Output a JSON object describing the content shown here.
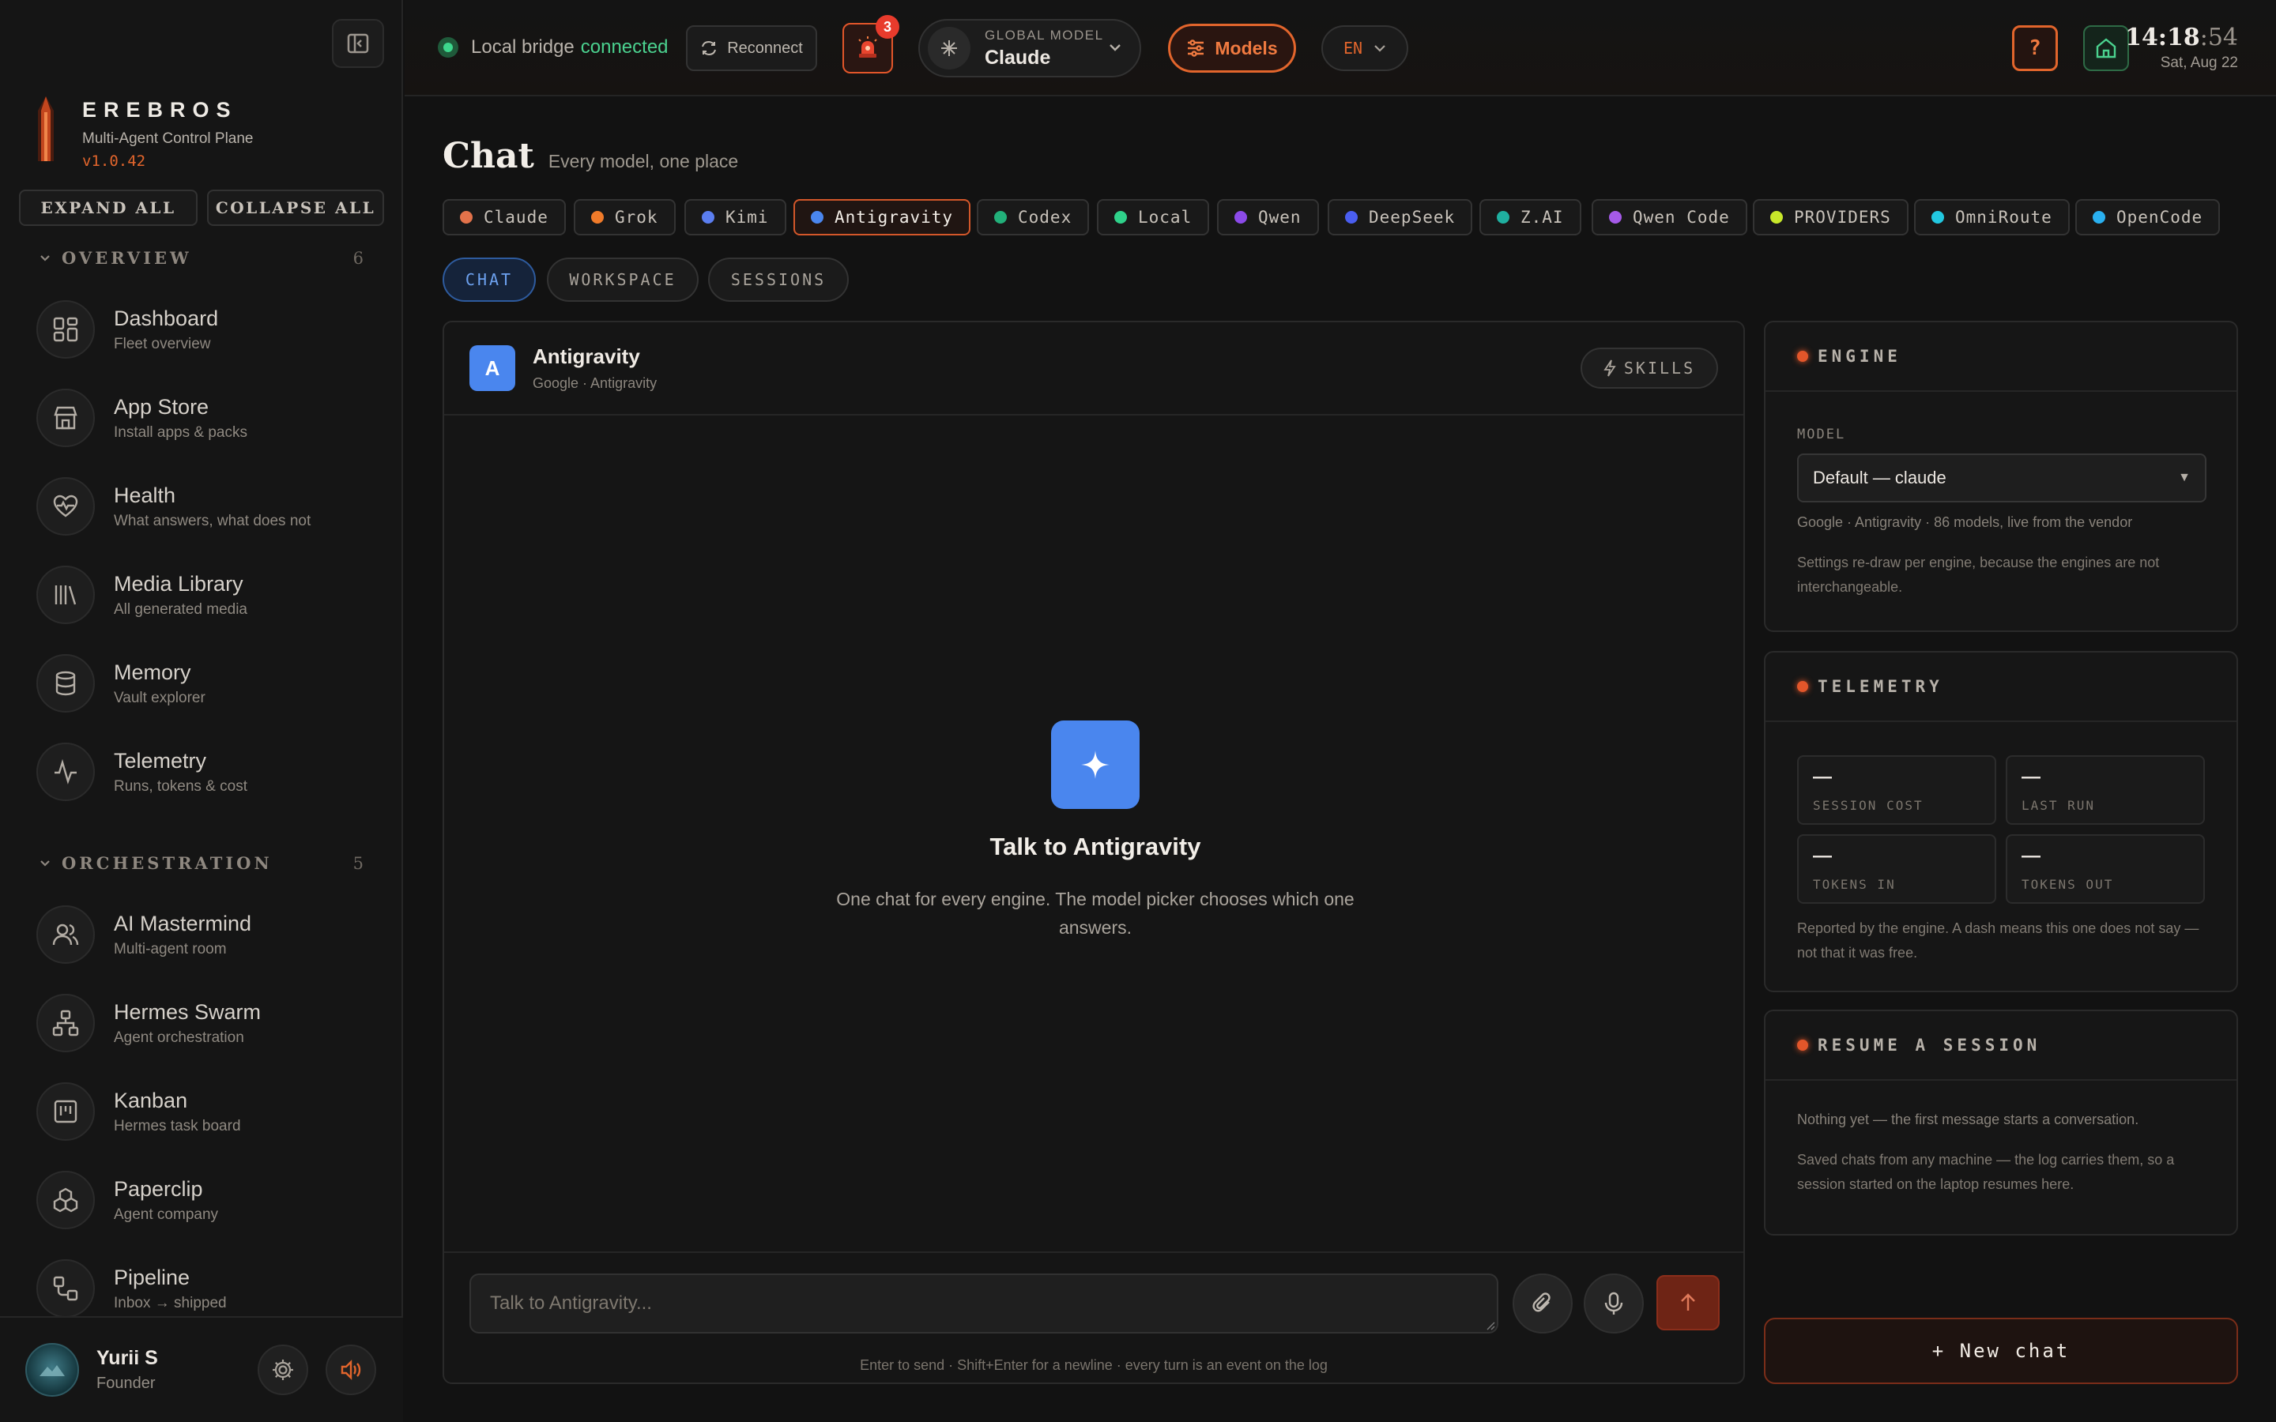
{
  "brand": {
    "name": "EREBROS",
    "subtitle": "Multi-Agent Control Plane",
    "version": "v1.0.42"
  },
  "sidebar": {
    "expand_all": "EXPAND ALL",
    "collapse_all": "COLLAPSE ALL",
    "sections": [
      {
        "title": "OVERVIEW",
        "count": "6",
        "items": [
          {
            "title": "Dashboard",
            "subtitle": "Fleet overview",
            "icon": "dashboard-icon"
          },
          {
            "title": "App Store",
            "subtitle": "Install apps & packs",
            "icon": "store-icon"
          },
          {
            "title": "Health",
            "subtitle": "What answers, what does not",
            "icon": "heart-pulse-icon"
          },
          {
            "title": "Media Library",
            "subtitle": "All generated media",
            "icon": "library-icon"
          },
          {
            "title": "Memory",
            "subtitle": "Vault explorer",
            "icon": "database-icon"
          },
          {
            "title": "Telemetry",
            "subtitle": "Runs, tokens & cost",
            "icon": "activity-icon"
          }
        ]
      },
      {
        "title": "ORCHESTRATION",
        "count": "5",
        "items": [
          {
            "title": "AI Mastermind",
            "subtitle": "Multi-agent room",
            "icon": "users-icon"
          },
          {
            "title": "Hermes Swarm",
            "subtitle": "Agent orchestration",
            "icon": "network-icon"
          },
          {
            "title": "Kanban",
            "subtitle": "Hermes task board",
            "icon": "kanban-icon"
          },
          {
            "title": "Paperclip",
            "subtitle": "Agent company",
            "icon": "boxes-icon"
          },
          {
            "title": "Pipeline",
            "subtitle": "Inbox → shipped",
            "icon": "workflow-icon"
          }
        ]
      }
    ],
    "user": {
      "name": "Yurii S",
      "role": "Founder"
    }
  },
  "topbar": {
    "bridge_label": "Local bridge",
    "bridge_status": "connected",
    "reconnect": "Reconnect",
    "alerts_count": "3",
    "global_model_label": "GLOBAL MODEL",
    "global_model_value": "Claude",
    "models_button": "Models",
    "language": "EN",
    "help": "?",
    "clock_time": "14:18",
    "clock_seconds": ":54",
    "clock_date": "Sat, Aug 22"
  },
  "page": {
    "title": "Chat",
    "subtitle": "Every model, one place"
  },
  "engines": [
    {
      "label": "Claude",
      "color": "#e2724a"
    },
    {
      "label": "Grok",
      "color": "#f07b2a"
    },
    {
      "label": "Kimi",
      "color": "#5b7ef0"
    },
    {
      "label": "Antigravity",
      "color": "#4a86ee",
      "active": true
    },
    {
      "label": "Codex",
      "color": "#22b07a"
    },
    {
      "label": "Local",
      "color": "#2fd18a"
    },
    {
      "label": "Qwen",
      "color": "#8b4ae8"
    },
    {
      "label": "DeepSeek",
      "color": "#4a5ef0"
    },
    {
      "label": "Z.AI",
      "color": "#1fb0a0"
    },
    {
      "label": "Qwen Code",
      "color": "#a55ae8"
    },
    {
      "label": "PROVIDERS",
      "color": "#c8e82a"
    },
    {
      "label": "OmniRoute",
      "color": "#22c8e0"
    },
    {
      "label": "OpenCode",
      "color": "#2ab0f0"
    }
  ],
  "view_tabs": [
    "CHAT",
    "WORKSPACE",
    "SESSIONS"
  ],
  "chat": {
    "engine_initial": "A",
    "engine_name": "Antigravity",
    "engine_meta": "Google · Antigravity",
    "skills": "SKILLS",
    "empty_title": "Talk to Antigravity",
    "empty_text": "One chat for every engine. The model picker chooses which one answers.",
    "input_placeholder": "Talk to Antigravity...",
    "hint": "Enter to send · Shift+Enter for a newline · every turn is an event on the log"
  },
  "engine_card": {
    "title": "ENGINE",
    "model_label": "MODEL",
    "model_value": "Default — claude",
    "model_note": "Google · Antigravity · 86 models, live from the vendor",
    "note": "Settings re-draw per engine, because the engines are not interchangeable."
  },
  "telemetry_card": {
    "title": "TELEMETRY",
    "metrics": [
      {
        "value": "—",
        "label": "SESSION COST"
      },
      {
        "value": "—",
        "label": "LAST RUN"
      },
      {
        "value": "—",
        "label": "TOKENS IN"
      },
      {
        "value": "—",
        "label": "TOKENS OUT"
      }
    ],
    "note": "Reported by the engine. A dash means this one does not say — not that it was free."
  },
  "resume_card": {
    "title": "RESUME A SESSION",
    "empty": "Nothing yet — the first message starts a conversation.",
    "note": "Saved chats from any machine — the log carries them, so a session started on the laptop resumes here."
  },
  "new_chat": "+ New chat",
  "colors": {
    "accent": "#e2652c",
    "engine_blue": "#4a86ee",
    "success": "#3dd68c"
  }
}
